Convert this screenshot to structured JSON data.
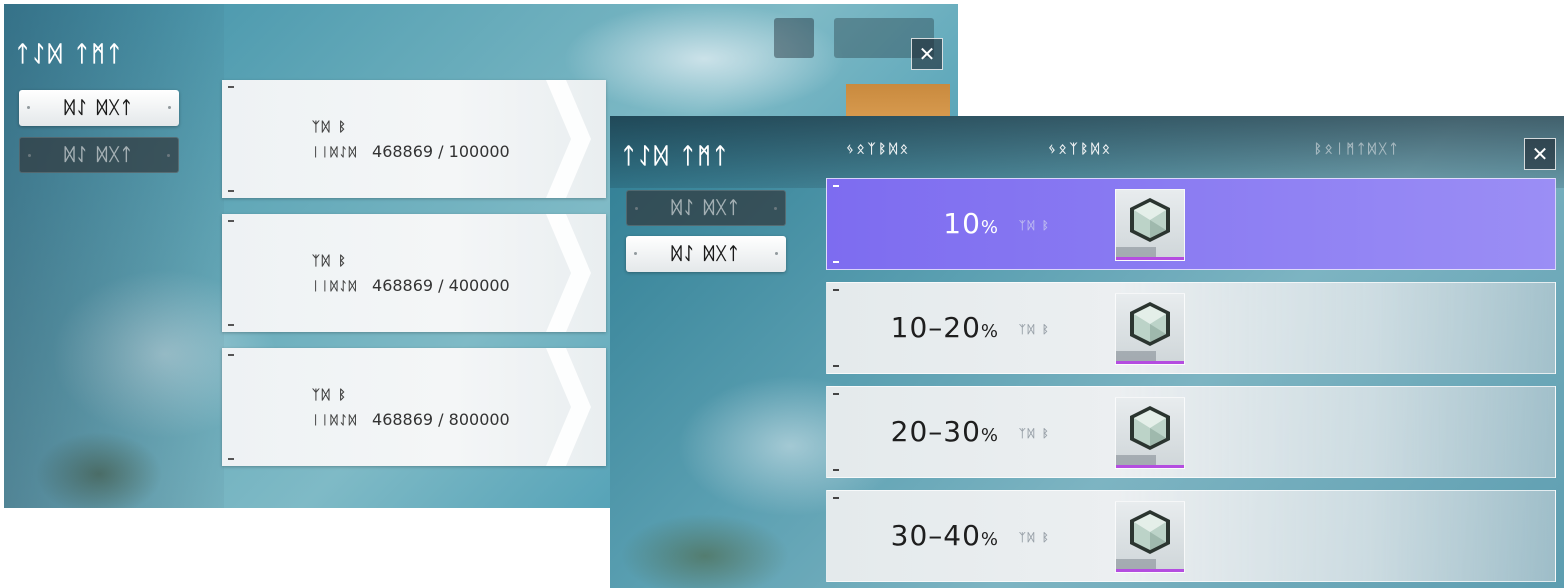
{
  "panel_left": {
    "title": "ᛏᛇᛞ ᛏᛗᛏ",
    "close_label": "✕",
    "tabs": [
      {
        "label": "ᛞᛇ ᛞᚷᛏ",
        "state": "active"
      },
      {
        "label": "ᛞᛇ ᛞᚷᛏ",
        "state": "inactive"
      }
    ],
    "cards": [
      {
        "line1": "ᛉᛞ ᛒ",
        "label": "ᛁᛁᛞᛇᛞ",
        "progress": "468869 / 100000",
        "fraction": 1.0
      },
      {
        "line1": "ᛉᛞ ᛒ",
        "label": "ᛁᛁᛞᛇᛞ",
        "progress": "468869 / 400000",
        "fraction": 1.0
      },
      {
        "line1": "ᛉᛞ ᛒ",
        "label": "ᛁᛁᛞᛇᛞ",
        "progress": "468869 / 800000",
        "fraction": 0.59
      }
    ]
  },
  "panel_right": {
    "title": "ᛏᛇᛞ ᛏᛗᛏ",
    "close_label": "✕",
    "tabs": [
      {
        "label": "ᛞᛇ ᛞᚷᛏ",
        "state": "inactive"
      },
      {
        "label": "ᛞᛇ ᛞᚷᛏ",
        "state": "active"
      }
    ],
    "columns": [
      "ᛃᛟᛉᛒᛞᛟ",
      "ᛃᛟᛉᛒᛞᛟ",
      "ᛒᛟᛁᛗᛏᛞᚷᛏ"
    ],
    "rows": [
      {
        "range": "10",
        "pct": "%",
        "suffix": "ᛉᛞ ᛒ",
        "highlight": true
      },
      {
        "range": "10–20",
        "pct": "%",
        "suffix": "ᛉᛞ ᛒ",
        "highlight": false
      },
      {
        "range": "20–30",
        "pct": "%",
        "suffix": "ᛉᛞ ᛒ",
        "highlight": false
      },
      {
        "range": "30–40",
        "pct": "%",
        "suffix": "ᛉᛞ ᛒ",
        "highlight": false
      }
    ]
  },
  "colors": {
    "highlight_row": "#7d6cf0",
    "item_rarity_bar": "#b44de0",
    "reward_chip": "#e4a95e"
  },
  "icons": {
    "close": "close-icon",
    "reward": "hexagon-crystal-icon",
    "chevron": "chevron-right-icon"
  }
}
